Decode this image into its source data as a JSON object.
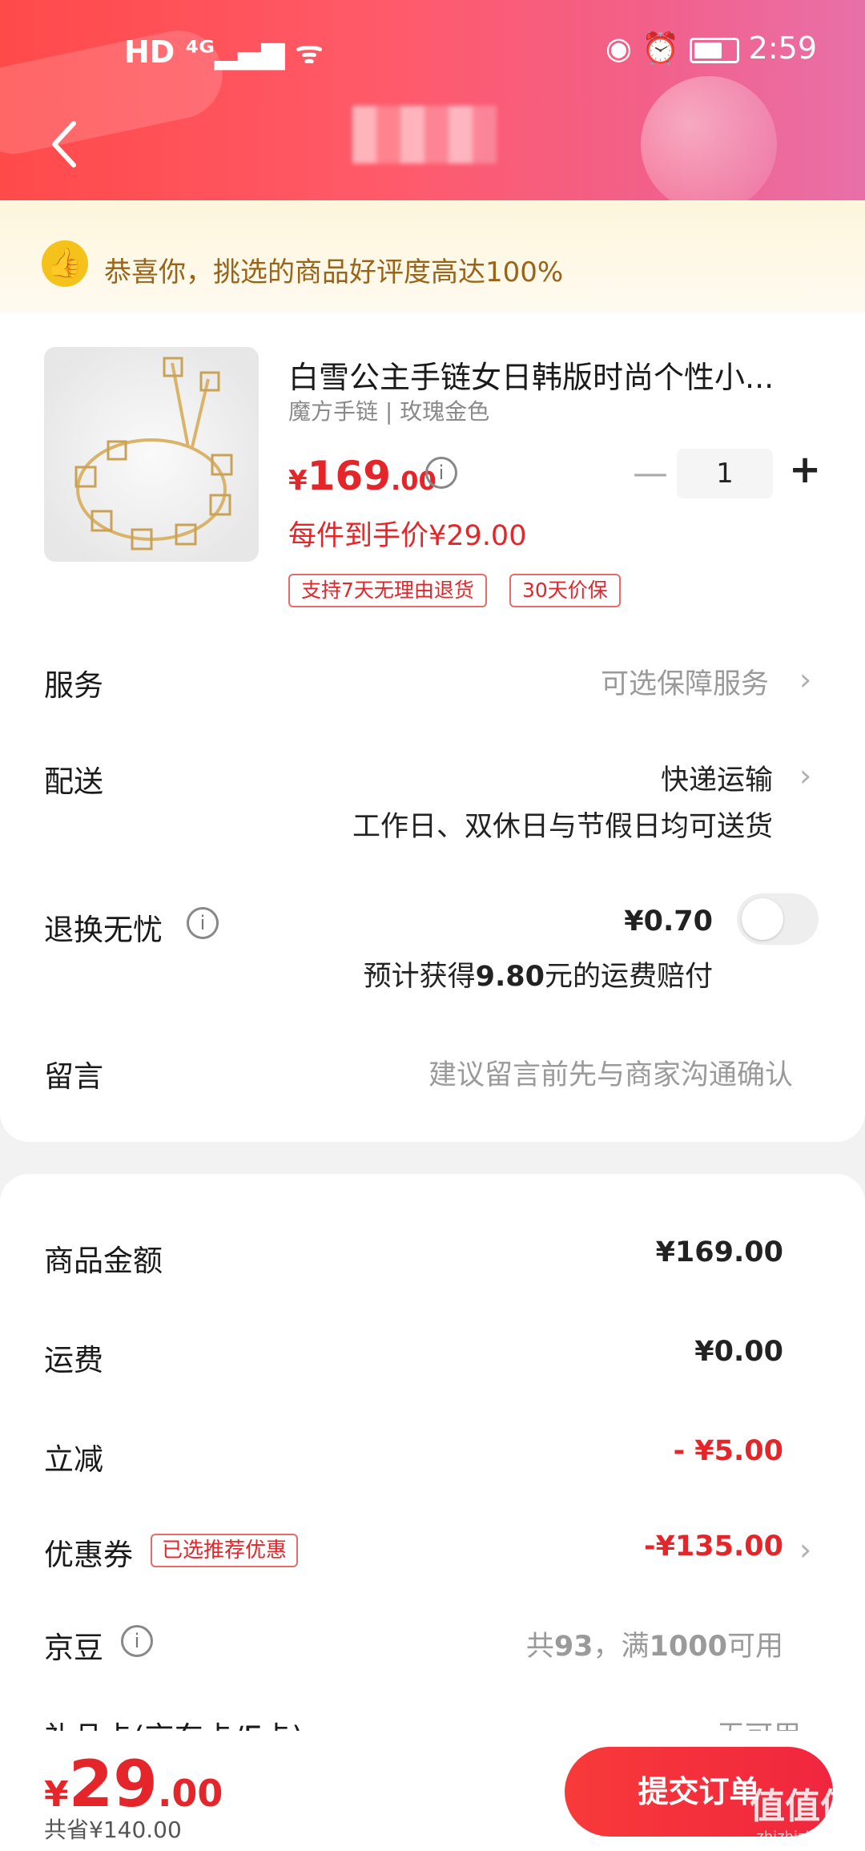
{
  "status_bar": {
    "left_icons": "HD ⁴ᴳ▂▄▆ ᯤ",
    "time": "2:59"
  },
  "promo": {
    "text": "恭喜你，挑选的商品好评度高达100%"
  },
  "product": {
    "title": "白雪公主手链女日韩版时尚个性小...",
    "spec": "魔方手链 | 玫瑰金色",
    "price_symbol": "¥",
    "price_int": "169",
    "price_dec": ".00",
    "quantity": "1",
    "unit_price": "每件到手价¥29.00",
    "tags": [
      "支持7天无理由退货",
      "30天价保"
    ]
  },
  "service": {
    "label": "服务",
    "value": "可选保障服务"
  },
  "delivery": {
    "label": "配送",
    "value": "快递运输",
    "note": "工作日、双休日与节假日均可送货"
  },
  "return": {
    "label": "退换无忧",
    "price": "¥0.70",
    "note_prefix": "预计获得",
    "note_amount": "9.80",
    "note_suffix": "元的运费赔付"
  },
  "message": {
    "label": "留言",
    "placeholder": "建议留言前先与商家沟通确认"
  },
  "summary": {
    "goods": {
      "label": "商品金额",
      "value": "¥169.00"
    },
    "shipping": {
      "label": "运费",
      "value": "¥0.00"
    },
    "discount": {
      "label": "立减",
      "value": "- ¥5.00"
    },
    "coupon": {
      "label": "优惠券",
      "badge": "已选推荐优惠",
      "value": "-¥135.00"
    },
    "beans": {
      "label": "京豆",
      "value_prefix": "共",
      "count": "93",
      "value_mid": "，满",
      "threshold": "1000",
      "value_suffix": "可用"
    },
    "cut_row": {
      "label": "礼品卡(京东卡/E卡)",
      "value": "无可用"
    }
  },
  "footer": {
    "total_symbol": "¥",
    "total_int": "29",
    "total_dec": ".00",
    "saved": "共省¥140.00",
    "submit_label": "提交订单",
    "watermark": "值值值",
    "watermark_url": "zhizhizhi.com"
  },
  "colors": {
    "accent_red": "#e4262a",
    "header_start": "#ff4a4a",
    "header_end": "#e870a8",
    "promo_text": "#9a6418"
  }
}
